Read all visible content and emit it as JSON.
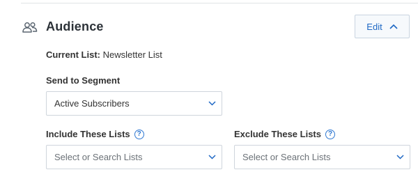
{
  "section": {
    "title": "Audience",
    "icon": "users-icon",
    "edit_label": "Edit",
    "edit_icon": "chevron-up-icon"
  },
  "current_list": {
    "label": "Current List:",
    "value": "Newsletter List"
  },
  "segment": {
    "label": "Send to Segment",
    "selected": "Active Subscribers"
  },
  "include_lists": {
    "label": "Include These Lists",
    "help": "?",
    "placeholder": "Select or Search Lists"
  },
  "exclude_lists": {
    "label": "Exclude These Lists",
    "help": "?",
    "placeholder": "Select or Search Lists"
  },
  "colors": {
    "accent": "#1d67c4",
    "help": "#2f78d2",
    "border": "#cfd5dc"
  }
}
